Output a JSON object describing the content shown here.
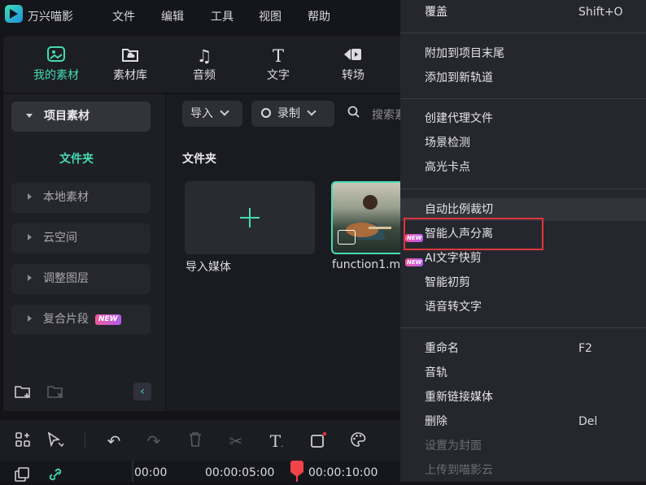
{
  "app": {
    "title": "万兴喵影"
  },
  "menu": {
    "file": "文件",
    "edit": "编辑",
    "tools": "工具",
    "view": "视图",
    "help": "帮助"
  },
  "tabs": [
    {
      "label": "我的素材",
      "icon": "my-media-icon"
    },
    {
      "label": "素材库",
      "icon": "stock-media-icon"
    },
    {
      "label": "音频",
      "icon": "music-note-icon"
    },
    {
      "label": "文字",
      "icon": "text-icon"
    },
    {
      "label": "转场",
      "icon": "transition-icon"
    }
  ],
  "sidebar": {
    "project": "项目素材",
    "folder": "文件夹",
    "items": [
      {
        "label": "本地素材"
      },
      {
        "label": "云空间"
      },
      {
        "label": "调整图层"
      },
      {
        "label": "复合片段",
        "badge": "NEW"
      }
    ]
  },
  "media": {
    "import_label": "导入",
    "record_label": "录制",
    "search_placeholder": "搜索素",
    "folder_title": "文件夹",
    "import_media_label": "导入媒体",
    "clip_name": "function1.m"
  },
  "timeline": {
    "ticks": [
      "00:00",
      "00:00:05:00",
      "00:00:10:00"
    ]
  },
  "context_menu": {
    "groups": [
      [
        {
          "label": "覆盖",
          "shortcut": "Shift+O"
        }
      ],
      [
        {
          "label": "附加到项目末尾"
        },
        {
          "label": "添加到新轨道"
        }
      ],
      [
        {
          "label": "创建代理文件"
        },
        {
          "label": "场景检测"
        },
        {
          "label": "高光卡点"
        }
      ],
      [
        {
          "label": "自动比例裁切"
        },
        {
          "label": "智能人声分离",
          "badge": "NEW"
        },
        {
          "label": "AI文字快剪",
          "badge": "NEW"
        },
        {
          "label": "智能初剪"
        },
        {
          "label": "语音转文字"
        }
      ],
      [
        {
          "label": "重命名",
          "shortcut": "F2"
        },
        {
          "label": "音轨"
        },
        {
          "label": "重新链接媒体"
        },
        {
          "label": "删除",
          "shortcut": "Del"
        },
        {
          "label": "设置为封面",
          "disabled": true
        },
        {
          "label": "上传到喵影云",
          "disabled": true
        }
      ]
    ]
  },
  "colors": {
    "accent": "#45dbb4",
    "highlight_border": "#e0353a",
    "badge_gradient": "#f05a9b"
  }
}
